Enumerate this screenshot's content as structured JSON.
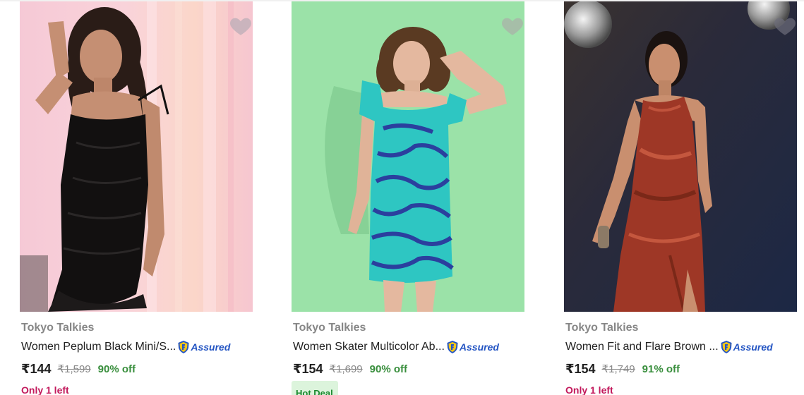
{
  "products": [
    {
      "brand": "Tokyo Talkies",
      "title": "Women Peplum Black Mini/S...",
      "assured": "Assured",
      "price": "₹144",
      "mrp": "₹1,599",
      "discount": "90% off",
      "note": "Only 1 left",
      "wishlisted": false,
      "image": "model-black-mini-dress"
    },
    {
      "brand": "Tokyo Talkies",
      "title": "Women Skater Multicolor Ab...",
      "assured": "Assured",
      "price": "₹154",
      "mrp": "₹1,699",
      "discount": "90% off",
      "badge": "Hot Deal",
      "wishlisted": false,
      "image": "model-blue-printed-dress"
    },
    {
      "brand": "Tokyo Talkies",
      "title": "Women Fit and Flare Brown ...",
      "assured": "Assured",
      "price": "₹154",
      "mrp": "₹1,749",
      "discount": "91% off",
      "note": "Only 1 left",
      "wishlisted": false,
      "image": "model-brown-satin-dress"
    }
  ],
  "icons": {
    "wishlist": "heart-icon",
    "assured": "assured-shield-icon"
  },
  "colors": {
    "price": "#212121",
    "mrp": "#878787",
    "discount": "#388e3c",
    "assured": "#2455c3",
    "stock_note": "#c2185b",
    "hot_deal_bg": "#dcf4dc",
    "hot_deal_text": "#1b8a2f"
  }
}
